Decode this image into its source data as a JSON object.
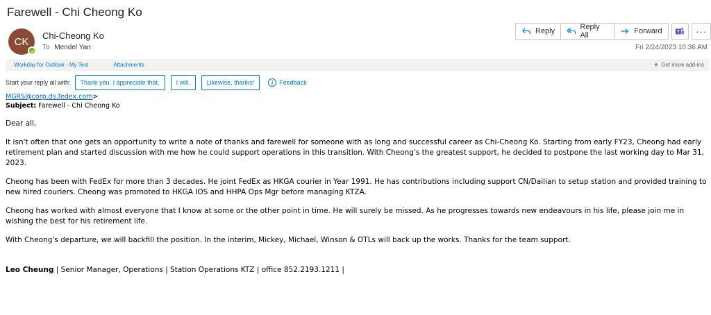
{
  "email": {
    "subject": "Farewell - Chi Cheong Ko",
    "sender": {
      "initials": "CK",
      "name": "Chi-Cheong Ko",
      "to_label": "To",
      "to_name": "Mendel Yan",
      "avatar_color": "#8a4a35",
      "presence_color": "#6bb700"
    },
    "date": "Fri 2/24/2023 10:36 AM",
    "actions": {
      "reply": "Reply",
      "reply_all": "Reply All",
      "forward": "Forward",
      "teams_icon": "teams-icon",
      "more": "···"
    },
    "addins": {
      "items": [
        "Workday for Outlook - My Test",
        "Attachments"
      ],
      "get_more": "Get more add-ins"
    },
    "quick_replies": {
      "prompt": "Start your reply all with:",
      "options": [
        "Thank you. I appreciate that.",
        "I will.",
        "Likewise, thanks!"
      ],
      "feedback": "Feedback"
    },
    "body": {
      "from_link": "MGRS@corp.ds.fedex.com",
      "from_suffix": ">",
      "subject_label": "Subject:",
      "subject_value": " Farewell - Chi Cheong Ko",
      "greeting": "Dear all,",
      "paragraphs": [
        "It isn't often that one gets an opportunity to write a note of thanks and farewell for someone with as long and successful career as Chi-Cheong Ko. Starting from early FY23, Cheong had early retirement plan and started discussion with me how he could support operations in this transition. With Cheong's the greatest support, he decided to postpone the last working day to Mar 31, 2023.",
        "Cheong has been with FedEx for more than 3 decades. He joint FedEx as HKGA courier in Year 1991. He has contributions including support CN/Dailian to setup station and provided training to new hired couriers. Cheong was promoted to HKGA IOS and HHPA Ops Mgr before managing KTZA.",
        "Cheong has worked with almost everyone that I know at some or the other point in time. He will surely be missed. As he progresses towards new endeavours in his life, please join me in wishing the best for his retirement life.",
        "With Cheong's departure, we will backfill the position. In the interim, Mickey, Michael, Winson & OTLs will back up the works. Thanks for the team support."
      ],
      "signature_name": "Leo Cheung",
      "signature_rest": " | Senior Manager, Operations | Station Operations KTZ  | office 852.2193.1211 |"
    }
  }
}
